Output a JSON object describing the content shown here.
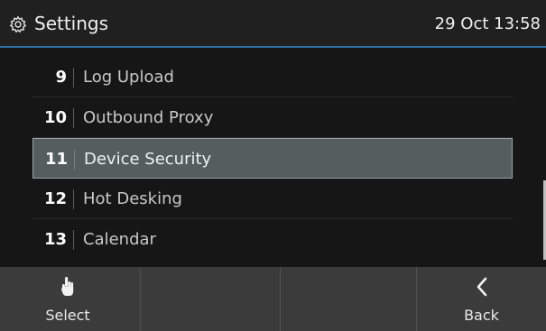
{
  "header": {
    "title": "Settings",
    "datetime": "29 Oct 13:58",
    "icon": "gear-icon",
    "accent_color": "#2f6f9f"
  },
  "menu": {
    "items": [
      {
        "number": "9",
        "label": "Log Upload",
        "selected": false
      },
      {
        "number": "10",
        "label": "Outbound Proxy",
        "selected": false
      },
      {
        "number": "11",
        "label": "Device Security",
        "selected": true
      },
      {
        "number": "12",
        "label": "Hot Desking",
        "selected": false
      },
      {
        "number": "13",
        "label": "Calendar",
        "selected": false
      }
    ],
    "selected_color": "#555d5f"
  },
  "softkeys": {
    "select": {
      "label": "Select",
      "icon": "hand-pointer-icon"
    },
    "empty2": {
      "label": ""
    },
    "empty3": {
      "label": ""
    },
    "back": {
      "label": "Back",
      "icon": "chevron-left-icon"
    }
  }
}
